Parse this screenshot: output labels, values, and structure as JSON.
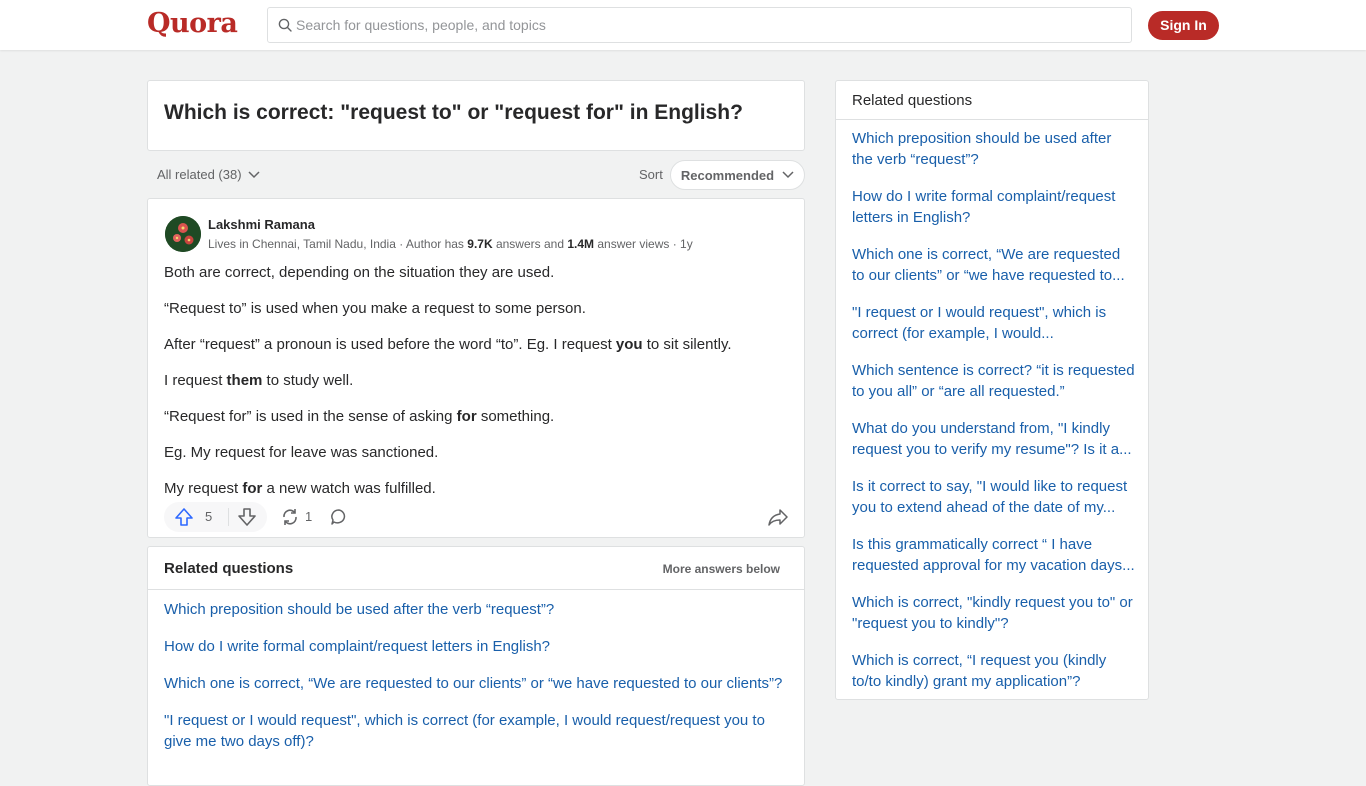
{
  "header": {
    "logo": "Quora",
    "search_placeholder": "Search for questions, people, and topics",
    "signin_label": "Sign In"
  },
  "question": {
    "title": "Which is correct: \"request to\" or \"request for\" in English?"
  },
  "filters": {
    "all_related": "All related (38)",
    "sort_label": "Sort",
    "sort_value": "Recommended"
  },
  "answer": {
    "author": "Lakshmi Ramana",
    "cred_prefix": "Lives in Chennai, Tamil Nadu, India · Author has ",
    "answers_count": "9.7K",
    "cred_mid": " answers and ",
    "views_count": "1.4M",
    "cred_suffix": " answer views · 1y",
    "paragraphs": [
      {
        "pre": "Both are correct, depending on the situation they are used.",
        "bold": "",
        "post": ""
      },
      {
        "pre": "“Request to” is used when you make a request to some person.",
        "bold": "",
        "post": ""
      },
      {
        "pre": "After “request” a pronoun is used before the word “to”. Eg. I request ",
        "bold": "you",
        "post": " to sit silently."
      },
      {
        "pre": "I request ",
        "bold": "them",
        "post": " to study well."
      },
      {
        "pre": "“Request for” is used in the sense of asking ",
        "bold": "for",
        "post": " something."
      },
      {
        "pre": "Eg. My request for leave was sanctioned.",
        "bold": "",
        "post": ""
      },
      {
        "pre": "My request ",
        "bold": "for",
        "post": " a new watch was fulfilled."
      }
    ],
    "upvotes": "5",
    "shares": "1"
  },
  "related_main": {
    "title": "Related questions",
    "more": "More answers below",
    "items": [
      "Which preposition should be used after the verb “request”?",
      "How do I write formal complaint/request letters in English?",
      "Which one is correct, “We are requested to our clients” or “we have requested to our clients”?",
      "\"I request or I would request\", which is correct (for example, I would request/request you to give me two days off)?"
    ]
  },
  "related_side": {
    "title": "Related questions",
    "items": [
      "Which preposition should be used after the verb “request”?",
      "How do I write formal complaint/request letters in English?",
      "Which one is correct, “We are requested to our clients” or “we have requested to...",
      "\"I request or I would request\", which is correct (for example, I would...",
      "Which sentence is correct? “it is requested to you all” or “are all requested.”",
      "What do you understand from, \"I kindly request you to verify my resume\"? Is it a...",
      "Is it correct to say, \"I would like to request you to extend ahead of the date of my...",
      "Is this grammatically correct “ I have requested approval for my vacation days...",
      "Which is correct, \"kindly request you to\" or \"request you to kindly\"?",
      "Which is correct, “I request you (kindly to/to kindly) grant my application”?"
    ]
  },
  "colors": {
    "brand": "#b92b27",
    "link": "#195faa",
    "upvote": "#2e69ff"
  },
  "icons": [
    "search-icon",
    "chevron-down-icon",
    "upvote-icon",
    "downvote-icon",
    "reshare-icon",
    "comment-icon",
    "share-forward-icon"
  ]
}
